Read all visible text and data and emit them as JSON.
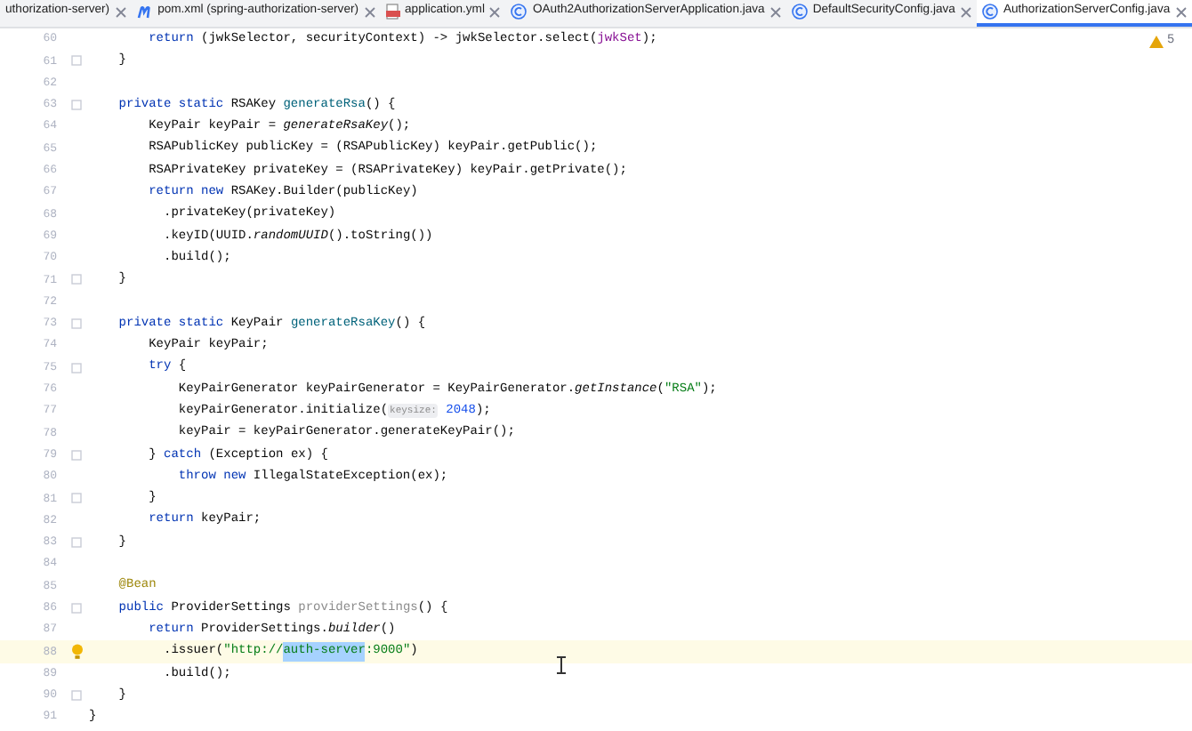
{
  "tabs": [
    {
      "label": "uthorization-server)",
      "kind": "plain",
      "selected": false
    },
    {
      "label": "pom.xml (spring-authorization-server)",
      "kind": "maven",
      "selected": false
    },
    {
      "label": "application.yml",
      "kind": "yaml",
      "selected": false
    },
    {
      "label": "OAuth2AuthorizationServerApplication.java",
      "kind": "class",
      "selected": false
    },
    {
      "label": "DefaultSecurityConfig.java",
      "kind": "class",
      "selected": false
    },
    {
      "label": "AuthorizationServerConfig.java",
      "kind": "class",
      "selected": true
    }
  ],
  "warnings": {
    "count": "5"
  },
  "editor": {
    "lines": [
      {
        "number": "60",
        "fold": false,
        "current": false,
        "tokens": [
          {
            "text": "        return",
            "kind": "keyword"
          },
          {
            "text": " (jwkSelector, securityContext) -> jwkSelector.select(",
            "kind": "plain"
          },
          {
            "text": "jwkSet",
            "kind": "field"
          },
          {
            "text": ");",
            "kind": "plain"
          }
        ]
      },
      {
        "number": "61",
        "fold": true,
        "current": false,
        "tokens": [
          {
            "text": "    }",
            "kind": "plain"
          }
        ]
      },
      {
        "number": "62",
        "fold": false,
        "current": false
      },
      {
        "number": "63",
        "fold": true,
        "current": false,
        "tokens": [
          {
            "text": "    private static",
            "kind": "keyword"
          },
          {
            "text": " RSAKey ",
            "kind": "plain"
          },
          {
            "text": "generateRsa",
            "kind": "method"
          },
          {
            "text": "() {",
            "kind": "plain"
          }
        ]
      },
      {
        "number": "64",
        "fold": false,
        "current": false,
        "tokens": [
          {
            "text": "        KeyPair keyPair = ",
            "kind": "plain"
          },
          {
            "text": "generateRsaKey",
            "kind": "static"
          },
          {
            "text": "();",
            "kind": "plain"
          }
        ]
      },
      {
        "number": "65",
        "fold": false,
        "current": false,
        "tokens": [
          {
            "text": "        RSAPublicKey publicKey = (RSAPublicKey) keyPair.getPublic();",
            "kind": "plain"
          }
        ]
      },
      {
        "number": "66",
        "fold": false,
        "current": false,
        "tokens": [
          {
            "text": "        RSAPrivateKey privateKey = (RSAPrivateKey) keyPair.getPrivate();",
            "kind": "plain"
          }
        ]
      },
      {
        "number": "67",
        "fold": false,
        "current": false,
        "tokens": [
          {
            "text": "        return new",
            "kind": "keyword"
          },
          {
            "text": " RSAKey.Builder(publicKey)",
            "kind": "plain"
          }
        ]
      },
      {
        "number": "68",
        "fold": false,
        "current": false,
        "tokens": [
          {
            "text": "          .privateKey(privateKey)",
            "kind": "plain"
          }
        ]
      },
      {
        "number": "69",
        "fold": false,
        "current": false,
        "tokens": [
          {
            "text": "          .keyID(UUID.",
            "kind": "plain"
          },
          {
            "text": "randomUUID",
            "kind": "static"
          },
          {
            "text": "().toString())",
            "kind": "plain"
          }
        ]
      },
      {
        "number": "70",
        "fold": false,
        "current": false,
        "tokens": [
          {
            "text": "          .build();",
            "kind": "plain"
          }
        ]
      },
      {
        "number": "71",
        "fold": true,
        "current": false,
        "tokens": [
          {
            "text": "    }",
            "kind": "plain"
          }
        ]
      },
      {
        "number": "72",
        "fold": false,
        "current": false
      },
      {
        "number": "73",
        "fold": true,
        "current": false,
        "tokens": [
          {
            "text": "    private static",
            "kind": "keyword"
          },
          {
            "text": " KeyPair ",
            "kind": "plain"
          },
          {
            "text": "generateRsaKey",
            "kind": "method"
          },
          {
            "text": "() {",
            "kind": "plain"
          }
        ]
      },
      {
        "number": "74",
        "fold": false,
        "current": false,
        "tokens": [
          {
            "text": "        KeyPair keyPair;",
            "kind": "plain"
          }
        ]
      },
      {
        "number": "75",
        "fold": true,
        "current": false,
        "tokens": [
          {
            "text": "        try",
            "kind": "keyword"
          },
          {
            "text": " {",
            "kind": "plain"
          }
        ]
      },
      {
        "number": "76",
        "fold": false,
        "current": false,
        "tokens": [
          {
            "text": "            KeyPairGenerator keyPairGenerator = KeyPairGenerator.",
            "kind": "plain"
          },
          {
            "text": "getInstance",
            "kind": "static"
          },
          {
            "text": "(",
            "kind": "plain"
          },
          {
            "text": "\"RSA\"",
            "kind": "string"
          },
          {
            "text": ");",
            "kind": "plain"
          }
        ]
      },
      {
        "number": "77",
        "fold": false,
        "current": false,
        "tokens": [
          {
            "text": "            keyPairGenerator.initialize(",
            "kind": "plain"
          },
          {
            "text": "keysize:",
            "kind": "hint"
          },
          {
            "text": " 2048",
            "kind": "number"
          },
          {
            "text": ");",
            "kind": "plain"
          }
        ]
      },
      {
        "number": "78",
        "fold": false,
        "current": false,
        "tokens": [
          {
            "text": "            keyPair = keyPairGenerator.generateKeyPair();",
            "kind": "plain"
          }
        ]
      },
      {
        "number": "79",
        "fold": true,
        "current": false,
        "tokens": [
          {
            "text": "        } ",
            "kind": "plain"
          },
          {
            "text": "catch",
            "kind": "keyword"
          },
          {
            "text": " (Exception ex) {",
            "kind": "plain"
          }
        ]
      },
      {
        "number": "80",
        "fold": false,
        "current": false,
        "tokens": [
          {
            "text": "            throw new",
            "kind": "keyword"
          },
          {
            "text": " IllegalStateException(ex);",
            "kind": "plain"
          }
        ]
      },
      {
        "number": "81",
        "fold": true,
        "current": false,
        "tokens": [
          {
            "text": "        }",
            "kind": "plain"
          }
        ]
      },
      {
        "number": "82",
        "fold": false,
        "current": false,
        "tokens": [
          {
            "text": "        return",
            "kind": "keyword"
          },
          {
            "text": " keyPair;",
            "kind": "plain"
          }
        ]
      },
      {
        "number": "83",
        "fold": true,
        "current": false,
        "tokens": [
          {
            "text": "    }",
            "kind": "plain"
          }
        ]
      },
      {
        "number": "84",
        "fold": false,
        "current": false
      },
      {
        "number": "85",
        "fold": false,
        "current": false,
        "tokens": [
          {
            "text": "    @Bean",
            "kind": "annotation"
          }
        ]
      },
      {
        "number": "86",
        "fold": true,
        "current": false,
        "tokens": [
          {
            "text": "    public",
            "kind": "keyword"
          },
          {
            "text": " ProviderSettings ",
            "kind": "plain"
          },
          {
            "text": "providerSettings",
            "kind": "unused"
          },
          {
            "text": "() {",
            "kind": "plain"
          }
        ]
      },
      {
        "number": "87",
        "fold": false,
        "current": false,
        "tokens": [
          {
            "text": "        return",
            "kind": "keyword"
          },
          {
            "text": " ProviderSettings.",
            "kind": "plain"
          },
          {
            "text": "builder",
            "kind": "static"
          },
          {
            "text": "()",
            "kind": "plain"
          }
        ]
      },
      {
        "number": "88",
        "fold": false,
        "current": true,
        "tokens": [
          {
            "text": "          .issuer(",
            "kind": "plain"
          },
          {
            "text": "\"http://",
            "kind": "string"
          },
          {
            "text": "auth-server",
            "kind": "selection"
          },
          {
            "text": ":9000\"",
            "kind": "string"
          },
          {
            "text": ")",
            "kind": "plain"
          }
        ]
      },
      {
        "number": "89",
        "fold": false,
        "current": false,
        "tokens": [
          {
            "text": "          .build();",
            "kind": "plain"
          }
        ]
      },
      {
        "number": "90",
        "fold": true,
        "current": false,
        "tokens": [
          {
            "text": "    }",
            "kind": "plain"
          }
        ]
      },
      {
        "number": "91",
        "fold": false,
        "current": false,
        "tokens": [
          {
            "text": "}",
            "kind": "plain"
          }
        ]
      }
    ]
  }
}
